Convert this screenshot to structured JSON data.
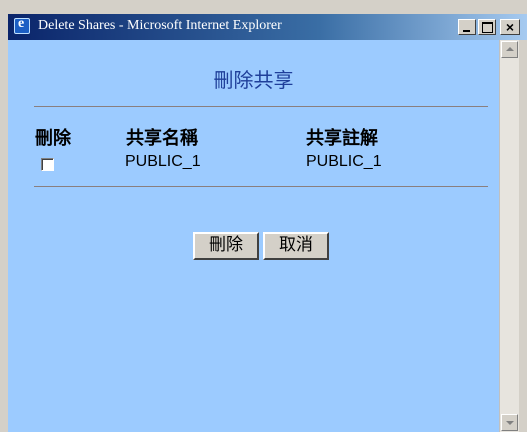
{
  "window": {
    "title": "Delete Shares - Microsoft Internet Explorer"
  },
  "page": {
    "title": "刪除共享",
    "columns": {
      "delete": "刪除",
      "name": "共享名稱",
      "comment": "共享註解"
    },
    "rows": [
      {
        "checked": false,
        "name": "PUBLIC_1",
        "comment": "PUBLIC_1"
      }
    ],
    "buttons": {
      "delete": "刪除",
      "cancel": "取消"
    }
  },
  "colors": {
    "content_bg": "#9ccbff",
    "title_color": "#1f3f9a"
  }
}
